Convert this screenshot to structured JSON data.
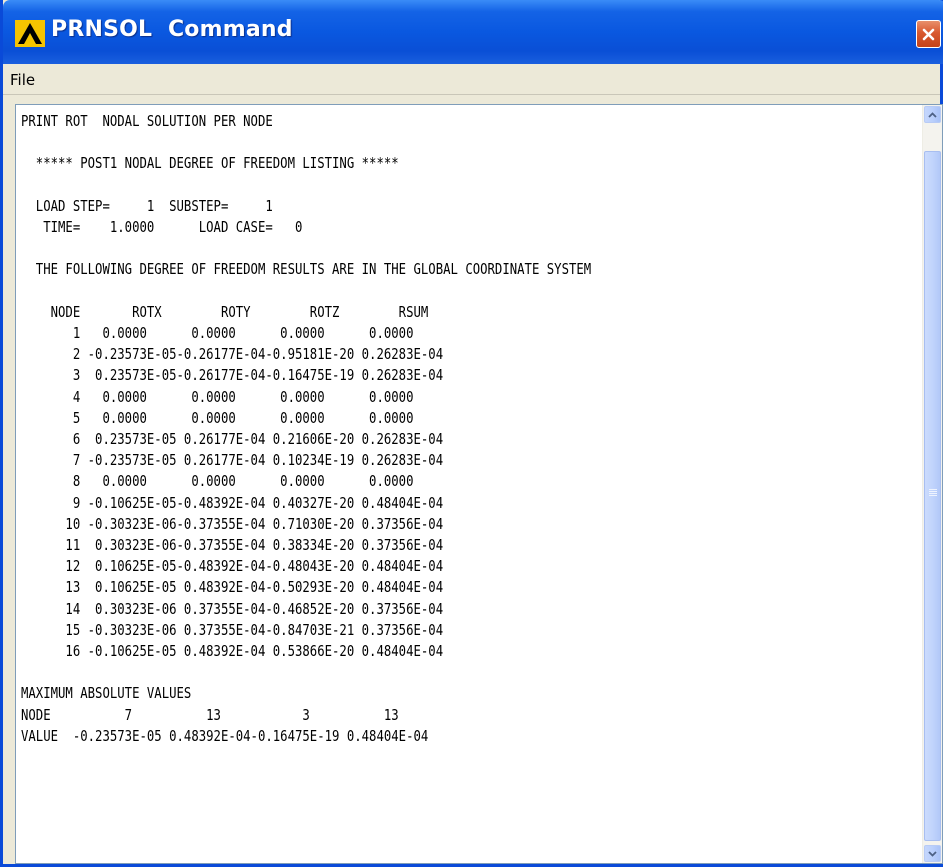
{
  "window": {
    "title": "PRNSOL  Command",
    "logo": "ansys-logo-icon",
    "close_icon": "close-icon"
  },
  "menu": {
    "items": [
      "File"
    ]
  },
  "output": {
    "lines": [
      "PRINT ROT  NODAL SOLUTION PER NODE",
      "",
      "  ***** POST1 NODAL DEGREE OF FREEDOM LISTING *****",
      "",
      "  LOAD STEP=     1  SUBSTEP=     1",
      "   TIME=    1.0000      LOAD CASE=   0",
      "",
      "  THE FOLLOWING DEGREE OF FREEDOM RESULTS ARE IN THE GLOBAL COORDINATE SYSTEM",
      "",
      "    NODE       ROTX        ROTY        ROTZ        RSUM",
      "       1   0.0000      0.0000      0.0000      0.0000",
      "       2 -0.23573E-05-0.26177E-04-0.95181E-20 0.26283E-04",
      "       3  0.23573E-05-0.26177E-04-0.16475E-19 0.26283E-04",
      "       4   0.0000      0.0000      0.0000      0.0000",
      "       5   0.0000      0.0000      0.0000      0.0000",
      "       6  0.23573E-05 0.26177E-04 0.21606E-20 0.26283E-04",
      "       7 -0.23573E-05 0.26177E-04 0.10234E-19 0.26283E-04",
      "       8   0.0000      0.0000      0.0000      0.0000",
      "       9 -0.10625E-05-0.48392E-04 0.40327E-20 0.48404E-04",
      "      10 -0.30323E-06-0.37355E-04 0.71030E-20 0.37356E-04",
      "      11  0.30323E-06-0.37355E-04 0.38334E-20 0.37356E-04",
      "      12  0.10625E-05-0.48392E-04-0.48043E-20 0.48404E-04",
      "      13  0.10625E-05 0.48392E-04-0.50293E-20 0.48404E-04",
      "      14  0.30323E-06 0.37355E-04-0.46852E-20 0.37356E-04",
      "      15 -0.30323E-06 0.37355E-04-0.84703E-21 0.37356E-04",
      "      16 -0.10625E-05 0.48392E-04 0.53866E-20 0.48404E-04",
      "",
      "MAXIMUM ABSOLUTE VALUES",
      "NODE          7          13           3          13",
      "VALUE  -0.23573E-05 0.48392E-04-0.16475E-19 0.48404E-04"
    ]
  },
  "scrollbar": {
    "up_icon": "scroll-up-arrow-icon",
    "down_icon": "scroll-down-arrow-icon"
  },
  "colors": {
    "titlebar": "#0a58e0",
    "close_button": "#d95a30",
    "text": "#000000"
  }
}
